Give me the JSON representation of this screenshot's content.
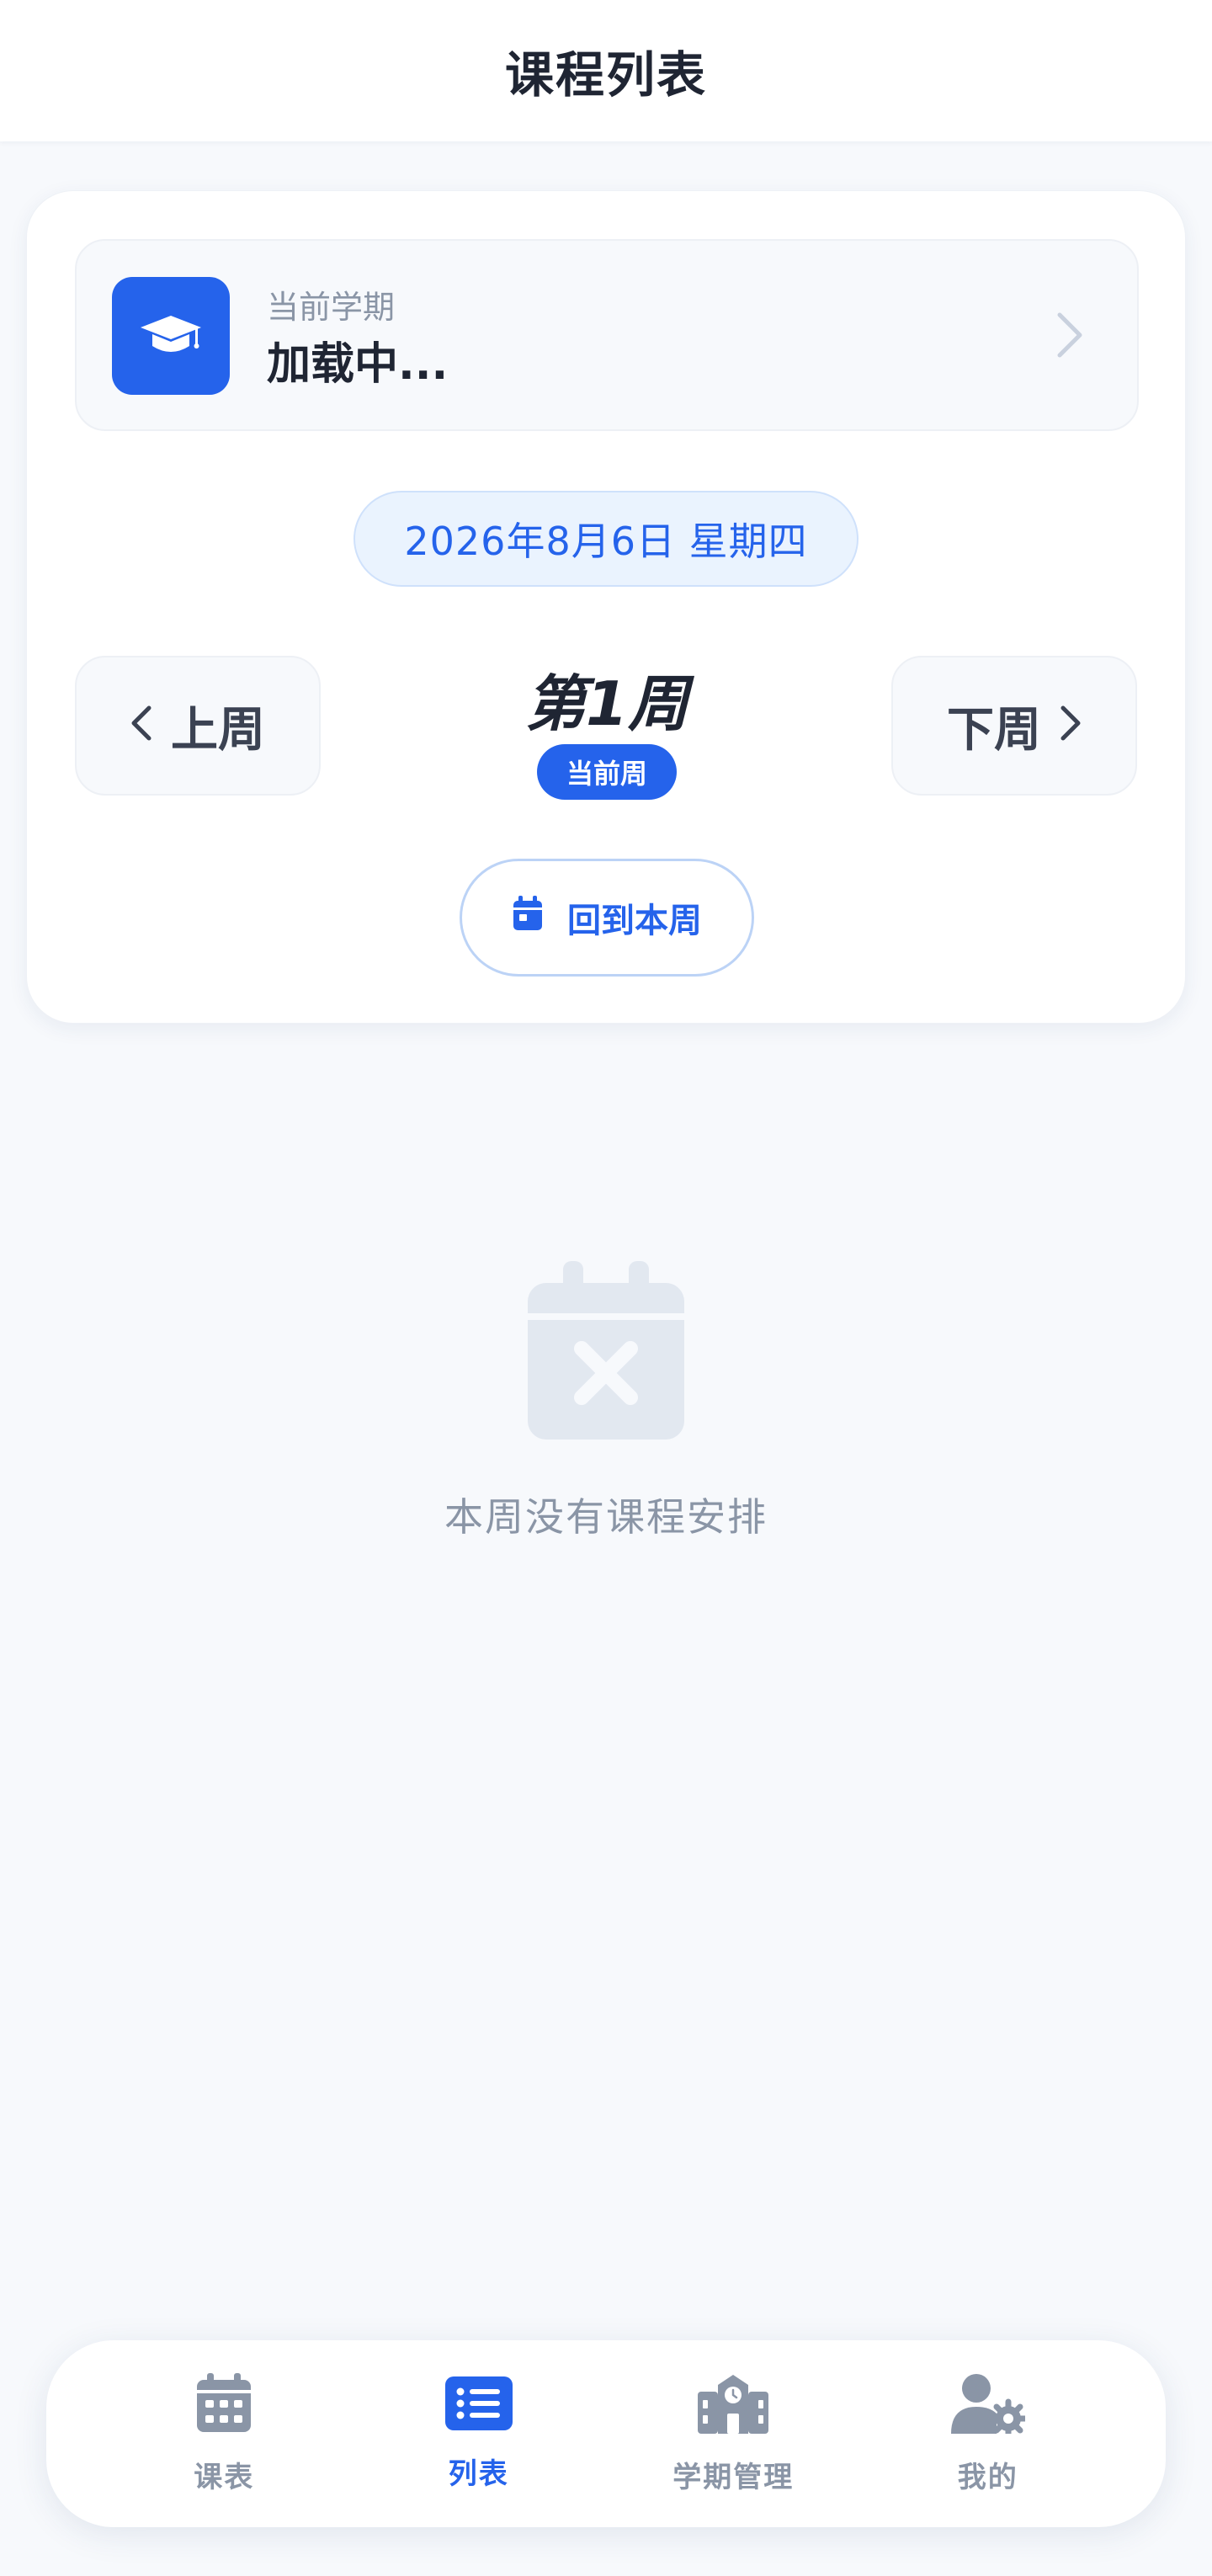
{
  "header": {
    "title": "课程列表"
  },
  "term": {
    "caption": "当前学期",
    "name": "加载中..."
  },
  "date": "2026年8月6日 星期四",
  "week": {
    "prev_label": "上周",
    "next_label": "下周",
    "title": "第1周",
    "badge": "当前周",
    "back_label": "回到本周"
  },
  "empty": {
    "message": "本周没有课程安排"
  },
  "tabbar": {
    "items": [
      {
        "label": "课表",
        "icon": "calendar-grid-icon",
        "active": false
      },
      {
        "label": "列表",
        "icon": "list-icon",
        "active": true
      },
      {
        "label": "学期管理",
        "icon": "school-building-icon",
        "active": false
      },
      {
        "label": "我的",
        "icon": "user-gear-icon",
        "active": false
      }
    ]
  },
  "colors": {
    "accent": "#2563eb",
    "muted": "#8a95a6",
    "background": "#f7f9fc"
  }
}
